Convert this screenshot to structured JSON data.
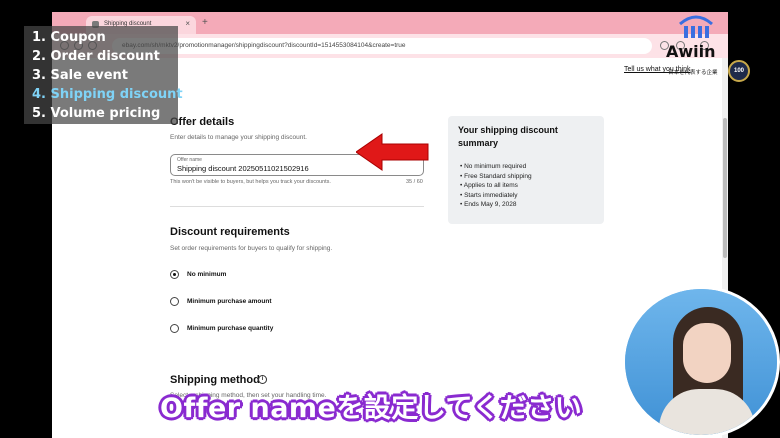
{
  "browser": {
    "tab_title": "Shipping discount",
    "tab_close": "×",
    "new_tab": "+",
    "url": "ebay.com/sh/mktv2/promotionmanager/shippingdiscount?discountId=1514553084104&create=true"
  },
  "page": {
    "feedback_link": "Tell us what you think",
    "offer_details": {
      "heading": "Offer details",
      "subtext": "Enter details to manage your shipping discount.",
      "field_label": "Offer name",
      "field_value": "Shipping discount 20250511021502916",
      "hint": "This won't be visible to buyers, but helps you track your discounts.",
      "char_count": "35 / 60"
    },
    "requirements": {
      "heading": "Discount requirements",
      "subtext": "Set order requirements for buyers to qualify for shipping.",
      "options": [
        "No minimum",
        "Minimum purchase amount",
        "Minimum purchase quantity"
      ],
      "selected_index": 0
    },
    "shipping_method": {
      "heading": "Shipping method",
      "info_glyph": "i",
      "subtext": "Select a shipping method, then set your handling time."
    },
    "summary": {
      "title": "Your shipping discount summary",
      "items": [
        "No minimum required",
        "Free Standard shipping",
        "Applies to all items",
        "Starts immediately",
        "Ends May 9, 2028"
      ]
    }
  },
  "overlay_menu": {
    "items": [
      "1. Coupon",
      "2. Order discount",
      "3. Sale event",
      "4. Shipping discount",
      "5. Volume pricing"
    ],
    "active_index": 3,
    "active_color": "#7fd3f7"
  },
  "branding": {
    "logo_text": "Awiin",
    "badge_text": "100",
    "tagline": "日本を代表する企業"
  },
  "caption": "Offer nameを設定してください",
  "colors": {
    "tab_bar": "#f4aab8",
    "arrow": "#e01818",
    "caption_outline": "#8a2bd0"
  }
}
